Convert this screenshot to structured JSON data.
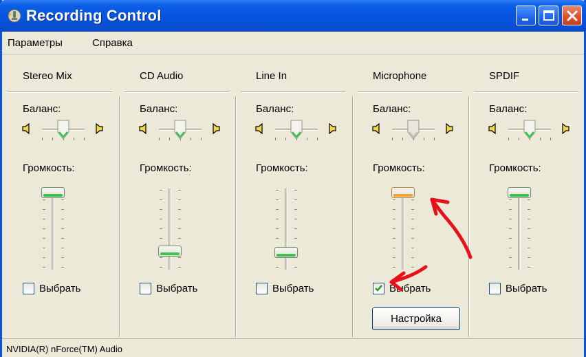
{
  "window": {
    "title": "Recording Control",
    "icon": "recording-control-icon"
  },
  "menu": {
    "items": [
      {
        "label": "Параметры"
      },
      {
        "label": "Справка"
      }
    ]
  },
  "balance_label": "Баланс:",
  "volume_label": "Громкость:",
  "select_label": "Выбрать",
  "channels": [
    {
      "name": "Stereo Mix",
      "balance": 0.5,
      "volume": 1.0,
      "selected": false
    },
    {
      "name": "CD Audio",
      "balance": 0.5,
      "volume": 0.1,
      "selected": false
    },
    {
      "name": "Line In",
      "balance": 0.5,
      "volume": 0.07,
      "selected": false
    },
    {
      "name": "Microphone",
      "balance": 0.5,
      "volume": 1.0,
      "selected": true
    },
    {
      "name": "SPDIF",
      "balance": 0.5,
      "volume": 1.0,
      "selected": false
    }
  ],
  "settings_button": "Настройка",
  "status": "NVIDIA(R) nForce(TM) Audio",
  "colors": {
    "titlebar": "#0653dd",
    "window_bg": "#ece9d8",
    "thumb_green": "#3cc24e",
    "thumb_orange": "#f3a23a",
    "annotation_red": "#e8101a"
  }
}
